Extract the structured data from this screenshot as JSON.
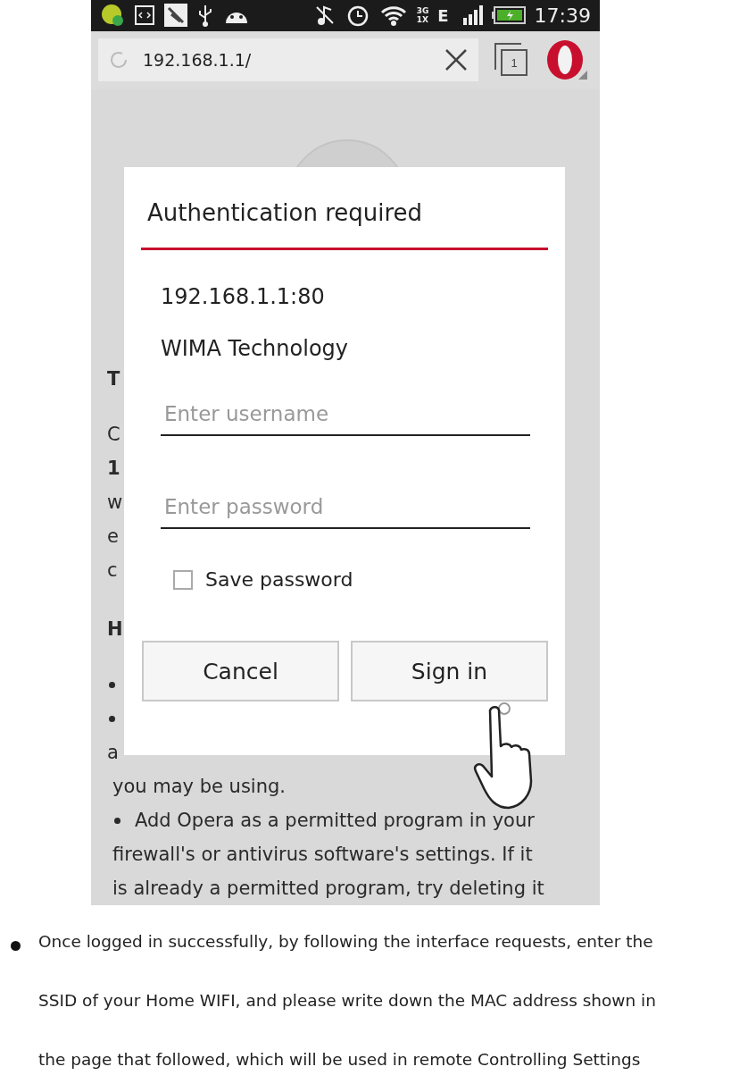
{
  "status_bar": {
    "network_labels": [
      "3G",
      "1X"
    ],
    "data_type": "E",
    "time": "17:39"
  },
  "browser": {
    "url": "192.168.1.1/",
    "tab_count": "1"
  },
  "background_page": [
    {
      "kind": "heading",
      "text": "T"
    },
    {
      "kind": "text",
      "text": "C"
    },
    {
      "kind": "bold",
      "text": "1"
    },
    {
      "kind": "text",
      "text": "w"
    },
    {
      "kind": "text",
      "text": "e"
    },
    {
      "kind": "text",
      "text": "c"
    },
    {
      "kind": "heading",
      "text": "H"
    },
    {
      "kind": "bullet"
    },
    {
      "kind": "bullet"
    },
    {
      "kind": "text",
      "text": "a"
    },
    {
      "kind": "text",
      "text": "you may be using."
    },
    {
      "kind": "bullet",
      "text": "Add Opera as a permitted program in your"
    },
    {
      "kind": "text",
      "text": "firewall's or antivirus software's settings. If it"
    },
    {
      "kind": "text",
      "text": "is already a permitted program, try deleting it"
    }
  ],
  "dialog": {
    "title": "Authentication required",
    "host": "192.168.1.1:80",
    "realm": "WIMA Technology",
    "username": {
      "placeholder": "Enter username"
    },
    "password": {
      "placeholder": "Enter password"
    },
    "save_password": {
      "label": "Save password",
      "checked": false
    },
    "buttons": [
      "Cancel",
      "Sign in"
    ]
  },
  "instruction": [
    "Once logged in successfully, by following the interface requests, enter the",
    "SSID of your Home WIFI, and please write down the MAC address shown in",
    "the page that followed, which will be used in remote Controlling Settings"
  ]
}
